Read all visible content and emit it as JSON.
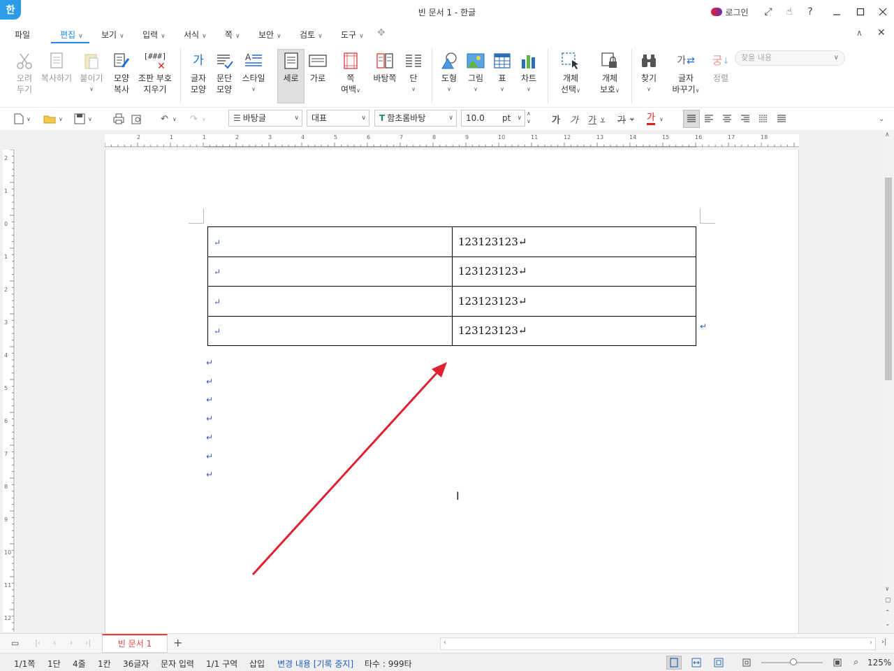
{
  "app": {
    "logo": "한",
    "title": "빈 문서 1 - 한글"
  },
  "titlebar": {
    "login_label": "로그인",
    "icons": [
      "expand-icon",
      "hand-icon",
      "help-icon",
      "minimize-icon",
      "maximize-icon",
      "close-icon"
    ],
    "help": "?"
  },
  "menubar": {
    "file": "파일",
    "items": [
      "편집",
      "보기",
      "입력",
      "서식",
      "쪽",
      "보안",
      "검토",
      "도구"
    ],
    "active": "편집",
    "search_placeholder": "찾을 내용"
  },
  "ribbon": {
    "cut": {
      "line1": "오려",
      "line2": "두기"
    },
    "copy": "복사하기",
    "paste": "붙이기",
    "format_copy": {
      "line1": "모양",
      "line2": "복사"
    },
    "clear_marks": {
      "line1": "조판 부호",
      "line2": "지우기",
      "icon_text": "[###]"
    },
    "char_shape": {
      "line1": "글자",
      "line2": "모양",
      "icon_text": "가"
    },
    "para_shape": {
      "line1": "문단",
      "line2": "모양"
    },
    "style": "스타일",
    "vertical": "세로",
    "horizontal": "가로",
    "page_margin": {
      "line1": "쪽",
      "line2": "여백"
    },
    "master_page": "바탕쪽",
    "columns": "단",
    "shape": "도형",
    "picture": "그림",
    "table": "표",
    "chart": "차트",
    "select_obj": {
      "line1": "개체",
      "line2": "선택"
    },
    "protect_obj": {
      "line1": "개체",
      "line2": "보호"
    },
    "find": "찾기",
    "replace": {
      "line1": "글자",
      "line2": "바꾸기",
      "icon_text": "가"
    },
    "sort": "정렬",
    "sort_icon_text": "궁"
  },
  "toolbar": {
    "style_combo": "바탕글",
    "lang_combo": "대표",
    "font_combo": "함초롬바탕",
    "size_value": "10.0",
    "size_unit": "pt",
    "bold_char": "가",
    "italic_char": "가",
    "underline_char": "가",
    "strike_char": "가",
    "color_char": "가",
    "accent_color": "#e02020"
  },
  "ruler": {
    "h_ticks": [
      "2",
      "1",
      "1",
      "2",
      "3",
      "4",
      "5",
      "6",
      "7",
      "8",
      "9",
      "10",
      "11",
      "12",
      "13",
      "14",
      "15",
      "16",
      "17",
      "18"
    ],
    "v_ticks": [
      "2",
      "1",
      "0",
      "1",
      "2",
      "3",
      "4",
      "5",
      "6",
      "7",
      "8",
      "9",
      "10",
      "11",
      "12"
    ]
  },
  "document": {
    "table_rows": [
      {
        "left": "↵",
        "right": "123123123↵"
      },
      {
        "left": "↵",
        "right": "123123123↵"
      },
      {
        "left": "↵",
        "right": "123123123↵"
      },
      {
        "left": "↵",
        "right": "123123123↵"
      }
    ],
    "table_end_mark": "↵",
    "paragraph_marks": [
      "↵",
      "↵",
      "↵",
      "↵",
      "↵",
      "↵",
      "↵"
    ],
    "annotation_color": "#e02030"
  },
  "tabs": {
    "doc_tab": "빈 문서 1",
    "add": "+"
  },
  "status": {
    "page": "1/1쪽",
    "column": "1단",
    "line": "4줄",
    "col": "1칸",
    "chars": "36글자",
    "input_mode": "문자 입력",
    "section": "1/1 구역",
    "insert_mode": "삽입",
    "track_changes": "변경 내용 [기록 중지]",
    "typing_speed": "타수 : 999타",
    "zoom": "125%",
    "track_color": "#1e5fc2"
  }
}
